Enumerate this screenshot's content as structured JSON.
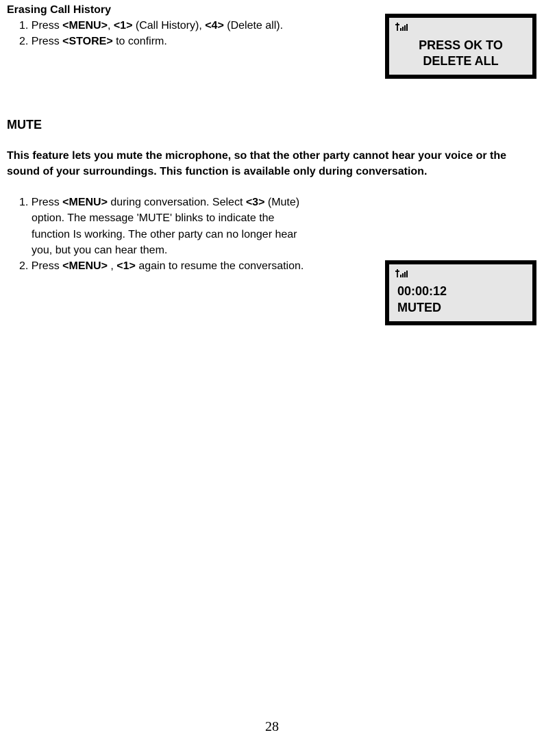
{
  "erasing": {
    "heading": "Erasing Call History",
    "step1_pre": "1. Press ",
    "step1_menu": "<MENU>",
    "step1_comma1": ", ",
    "step1_k1": "<1>",
    "step1_call_history": " (Call History), ",
    "step1_k4": "<4>",
    "step1_suffix": " (Delete all).",
    "step2_pre": "2. Press ",
    "step2_store": "<STORE>",
    "step2_suffix": " to confirm."
  },
  "mute": {
    "heading": "MUTE",
    "desc": "This feature lets you mute the microphone, so that the other party cannot hear your voice or the sound of your surroundings. This function is available only during conversation.",
    "step1_a": "1. Press ",
    "step1_menu": "<MENU>",
    "step1_b": " during conversation. Select ",
    "step1_k3": "<3>",
    "step1_c": " (Mute)",
    "step1_line2": "option. The message 'MUTE' blinks to indicate the",
    "step1_line3": "function Is working. The other party can no longer hear",
    "step1_line4": "you, but you can hear them.",
    "step2_a": "2. Press ",
    "step2_menu": "<MENU>",
    "step2_b": " , ",
    "step2_k1": "<1>",
    "step2_c": " again to resume the conversation."
  },
  "screen1": {
    "line1": "PRESS OK TO",
    "line2": "DELETE ALL"
  },
  "screen2": {
    "line1": "00:00:12",
    "line2": "MUTED"
  },
  "page_number": "28"
}
